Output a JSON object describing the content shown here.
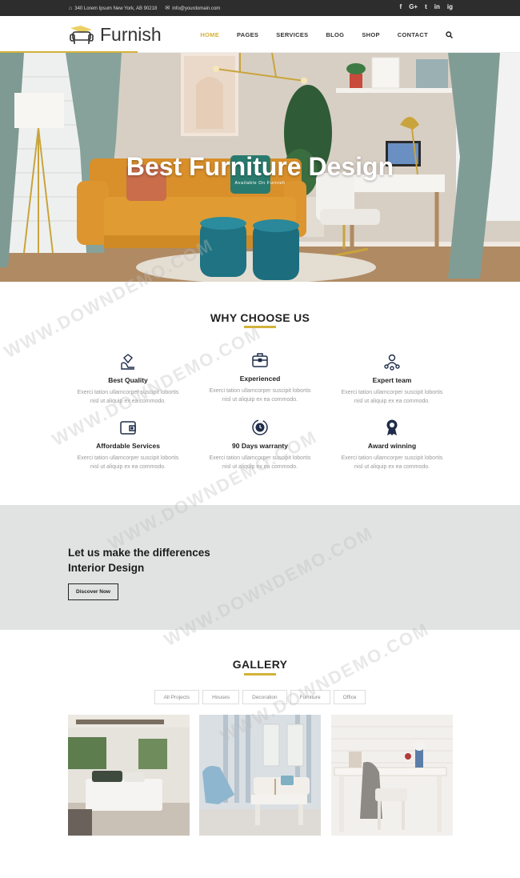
{
  "topbar": {
    "address": "340 Lorem Ipsum New York, AB 90218",
    "email": "info@yourdomain.com",
    "social": [
      "f",
      "G+",
      "t",
      "in",
      "ig"
    ]
  },
  "header": {
    "brand": "Furnish",
    "nav": [
      "HOME",
      "PAGES",
      "SERVICES",
      "BLOG",
      "SHOP",
      "CONTACT"
    ],
    "active_nav": "HOME"
  },
  "hero": {
    "title": "Best Furniture Design",
    "subtitle": "Available On Furnish"
  },
  "why": {
    "title": "WHY CHOOSE US",
    "features": [
      {
        "name": "Best Quality",
        "icon": "diamond-hand-icon",
        "desc1": "Exerci tation ullamcorper suscipit lobortis",
        "desc2": "nisl ut aliquip ex ea commodo."
      },
      {
        "name": "Experienced",
        "icon": "briefcase-icon",
        "desc1": "Exerci tation ullamcorper suscipit lobortis",
        "desc2": "nisl ut aliquip ex ea commodo."
      },
      {
        "name": "Expert team",
        "icon": "team-icon",
        "desc1": "Exerci tation ullamcorper suscipit lobortis",
        "desc2": "nisl ut aliquip ex ea commodo."
      },
      {
        "name": "Affordable Services",
        "icon": "wallet-icon",
        "desc1": "Exerci tation ullamcorper suscipit lobortis",
        "desc2": "nisl ut aliquip ex ea commodo."
      },
      {
        "name": "90 Days warranty",
        "icon": "warranty-icon",
        "desc1": "Exerci tation ullamcorper suscipit lobortis",
        "desc2": "nisl ut aliquip ex ea commodo."
      },
      {
        "name": "Award winning",
        "icon": "award-icon",
        "desc1": "Exerci tation ullamcorper suscipit lobortis",
        "desc2": "nisl ut aliquip ex ea commodo."
      }
    ]
  },
  "band": {
    "line1": "Let us make the differences",
    "line2": "Interior Design",
    "button": "Discover Now"
  },
  "gallery": {
    "title": "GALLERY",
    "filters": [
      "All Projects",
      "Houses",
      "Decoration",
      "Furniture",
      "Office"
    ]
  },
  "watermark": "WWW.DOWNDEMO.COM",
  "colors": {
    "accent": "#d3b23a",
    "dark": "#2d2d2d",
    "band": "#e1e2e2"
  }
}
